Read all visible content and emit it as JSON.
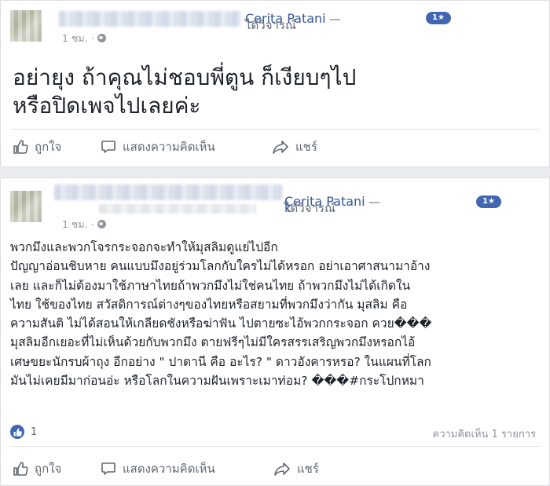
{
  "posts": [
    {
      "commenter_action": "ได้วิจารณ์",
      "page_name": "Cerita Patani",
      "dash": "—",
      "fan_badge": "1★",
      "timestamp": "1 ชม. ·",
      "message": "อย่ายุง ถ้าคุณไม่ชอบพี่ตูน ก็เงียบๆไป\nหรือปิดเพจไปเลยค่ะ",
      "actions": {
        "like": "ถูกใจ",
        "comment": "แสดงความคิดเห็น",
        "share": "แชร์"
      }
    },
    {
      "name_tail": "k",
      "commenter_action": "ได้วิจารณ์",
      "page_name": "Cerita Patani",
      "dash": "—",
      "fan_badge": "1★",
      "timestamp": "1 ชม. ·",
      "message": "พวกมึงและพวกโจรกระจอกจะทำให้มุสลิมดูแย่ไปอีก\nปัญญาอ่อนชิบหาย คนแบบมึงอยู่ร่วมโลกกับใครไม่ได้หรอก อย่าเอาศาสนามาอ้าง\nเลย และก็ไม่ต้องมาใช้ภาษาไทยถ้าพวกมึงไม่ใช่คนไทย ถ้าพวกมึงไม่ได้เกิดใน\nไทย ใช้ของไทย สวัสดิการณ์ต่างๆของไทยหรือสยามที่พวกมึงว่ากัน มุสลิม คือ\nความสันติ ไม่ได้สอนให้เกลียดชังหรือฆ่าฟัน ไปตายซะไอ้พวกกระจอก ควย���\nมุสลิมอีกเยอะที่ไม่เห็นด้วยกับพวกมึง ตายฟรีๆไม่มีใครสรรเสริญพวกมึงหรอกไอ้\nเศษขยะนักรบผ้าถุง อีกอย่าง \" ปาตานี คือ อะไร? \" ดาวอังคารหรอ? ในแผนที่โลก\nมันไม่เคยมีมาก่อนอ่ะ หรือโลกในความฝันเพราะเมาท่อม? ���#กระโปกหมา",
      "like_count": "1",
      "comment_count": "ความคิดเห็น 1 รายการ",
      "actions": {
        "like": "ถูกใจ",
        "comment": "แสดงความคิดเห็น",
        "share": "แชร์"
      }
    }
  ],
  "colors": {
    "facebook_blue": "#4267b2",
    "link_blue": "#365899",
    "muted_gray": "#606770",
    "background": "#e9ebee"
  },
  "icons": [
    "globe-icon",
    "thumbs-up-icon",
    "comment-bubble-icon",
    "share-arrow-icon",
    "like-reaction-icon"
  ]
}
